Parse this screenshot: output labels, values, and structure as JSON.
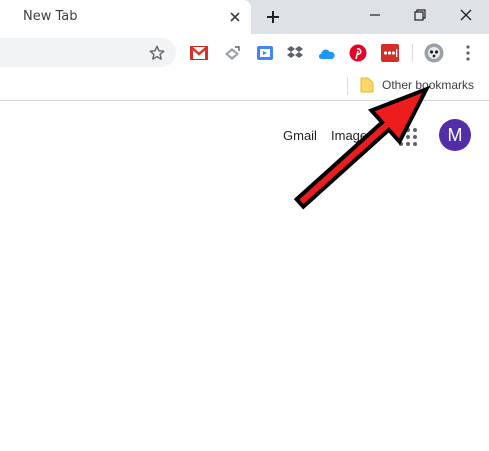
{
  "tab": {
    "title": "New Tab"
  },
  "window_controls": {
    "minimize_icon": "minimize-icon",
    "restore_icon": "restore-icon",
    "close_icon": "close-icon"
  },
  "toolbar": {
    "extensions": [
      "gmail-icon",
      "feedly-icon",
      "cloud-drive-icon",
      "dropbox-icon",
      "onedrive-icon",
      "pinterest-icon",
      "lastpass-icon",
      "profile-extension-icon"
    ],
    "menu_icon": "more-vertical-icon"
  },
  "bookmarks": {
    "other_label": "Other bookmarks"
  },
  "content": {
    "gmail": "Gmail",
    "images": "Images",
    "avatar_letter": "M"
  },
  "colors": {
    "tabstrip": "#dee1e6",
    "omnibox": "#f1f3f4",
    "avatar": "#512da8",
    "annotation_arrow": "#ee1c1c"
  }
}
